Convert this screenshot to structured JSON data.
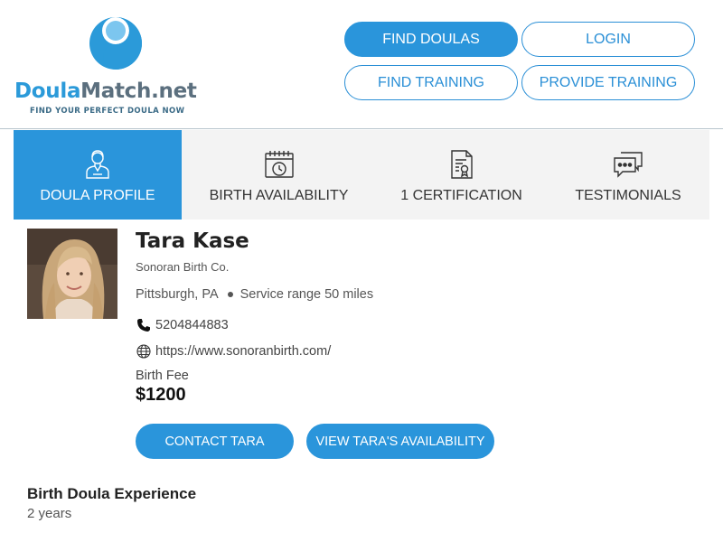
{
  "logo": {
    "name_part1": "Doula",
    "name_part2": "Match.net",
    "tagline": "FIND YOUR PERFECT DOULA NOW"
  },
  "nav": {
    "find_doulas": "FIND DOULAS",
    "login": "LOGIN",
    "find_training": "FIND TRAINING",
    "provide_training": "PROVIDE TRAINING"
  },
  "tabs": [
    {
      "label": "DOULA PROFILE",
      "icon": "person-icon",
      "active": true
    },
    {
      "label": "BIRTH AVAILABILITY",
      "icon": "calendar-clock-icon",
      "active": false
    },
    {
      "label": "1 CERTIFICATION",
      "icon": "certificate-icon",
      "active": false
    },
    {
      "label": "TESTIMONIALS",
      "icon": "chat-bubbles-icon",
      "active": false
    }
  ],
  "profile": {
    "name": "Tara Kase",
    "company": "Sonoran Birth Co.",
    "city": "Pittsburgh, PA",
    "service_range": "Service range 50 miles",
    "phone": "5204844883",
    "website": "https://www.sonoranbirth.com/",
    "fee_label": "Birth Fee",
    "fee_value": "$1200"
  },
  "actions": {
    "contact": "CONTACT TARA",
    "availability": "VIEW TARA'S AVAILABILITY"
  },
  "experience": {
    "title": "Birth Doula Experience",
    "value": "2 years"
  },
  "colors": {
    "primary": "#2a95db",
    "tab_bg": "#f3f3f3",
    "text_dark": "#222222"
  }
}
